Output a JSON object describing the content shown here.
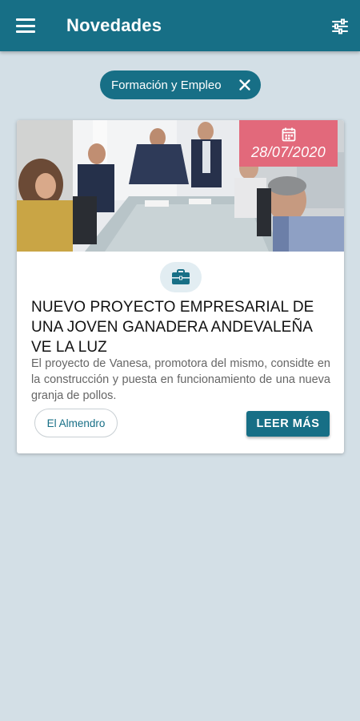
{
  "appbar": {
    "title": "Novedades",
    "menu_icon": "menu-icon",
    "filter_icon": "sliders-icon",
    "background": "#176f86"
  },
  "filter_chip": {
    "label": "Formación y Empleo",
    "close_icon": "close-icon"
  },
  "news": [
    {
      "date": "28/07/2020",
      "date_icon": "calendar-icon",
      "category_icon": "briefcase-icon",
      "title": "NUEVO PROYECTO EMPRESARIAL DE UNA JOVEN GANADERA ANDEVALEÑA VE LA LUZ",
      "summary": "El proyecto de Vanesa, promotora del mismo, considte en la construcción y puesta en funcionamiento de una nueva granja de pollos.",
      "place": "El Almendro",
      "read_more": "LEER MÁS",
      "accent": "#e2697b"
    }
  ],
  "colors": {
    "primary": "#176f86",
    "background": "#d3dfe6",
    "date_badge": "#e2697b"
  }
}
